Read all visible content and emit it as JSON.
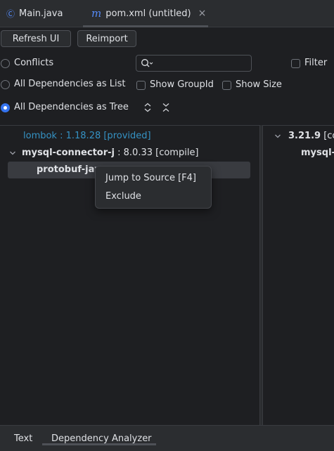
{
  "tabs": [
    {
      "icon": "Ⓒ",
      "label": "Main.java",
      "icon_color": "#548af7"
    },
    {
      "icon": "m",
      "label": "pom.xml (untitled)",
      "icon_color": "#548af7",
      "close": "×"
    }
  ],
  "toolbar": {
    "refresh_label": "Refresh UI",
    "reimport_label": "Reimport"
  },
  "options": {
    "conflicts": "Conflicts",
    "as_list": "All Dependencies as List",
    "as_tree": "All Dependencies as Tree",
    "filter": "Filter",
    "show_groupid": "Show GroupId",
    "show_size": "Show Size",
    "selected_view": "All Dependencies as Tree"
  },
  "tree": [
    {
      "name": "lombok",
      "version": " : 1.18.28 [provided]"
    },
    {
      "name": "mysql-connector-j",
      "version": " : 8.0.33 [compile]"
    },
    {
      "name": "protobuf-java",
      "version": ""
    }
  ],
  "right_tree": [
    {
      "name": "3.21.9",
      "version": " [co"
    },
    {
      "name": "mysql-c",
      "version": ""
    }
  ],
  "context_menu": {
    "jump": "Jump to Source [F4]",
    "exclude": "Exclude"
  },
  "bottom_tabs": [
    "Text",
    "Dependency Analyzer"
  ],
  "colors": {
    "accent": "#3574f0",
    "link": "#3592c4",
    "bg": "#1e1f22"
  }
}
